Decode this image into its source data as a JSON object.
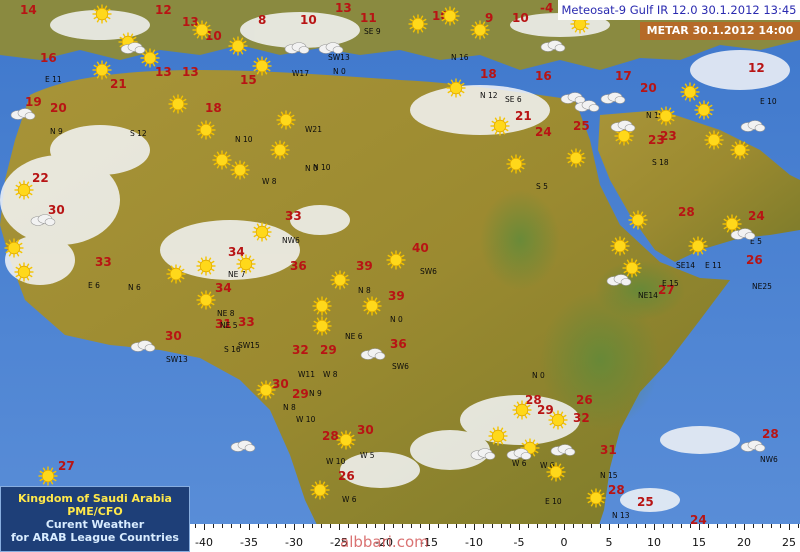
{
  "header": {
    "satellite_line": "Meteosat-9 Gulf IR 12.0  30.1.2012 13:45",
    "metar_line": "METAR 30.1.2012 14:00"
  },
  "info_box": {
    "line1": "Kingdom of Saudi Arabia",
    "line2": "PME/CFO",
    "line3": "Curent Weather",
    "line4": "for ARAB League Countries"
  },
  "watermark": "albbari.com",
  "longitude_scale": [
    "-40",
    "-35",
    "-30",
    "-25",
    "-20",
    "-15",
    "-10",
    "-5",
    "0",
    "5",
    "10",
    "15",
    "20",
    "25"
  ],
  "labels": [
    {
      "t": "14",
      "k": "temp"
    },
    {
      "t": "12",
      "k": "temp"
    },
    {
      "t": "13",
      "k": "temp"
    },
    {
      "t": "10",
      "k": "temp"
    },
    {
      "t": "8",
      "k": "temp"
    },
    {
      "t": "10",
      "k": "temp"
    },
    {
      "t": "13",
      "k": "temp"
    },
    {
      "t": "11",
      "k": "temp"
    },
    {
      "t": "10",
      "k": "temp"
    },
    {
      "t": "9",
      "k": "temp"
    },
    {
      "t": "10",
      "k": "temp"
    },
    {
      "t": "-4",
      "k": "temp"
    },
    {
      "t": "16",
      "k": "temp"
    },
    {
      "t": "19",
      "k": "temp"
    },
    {
      "t": "20",
      "k": "temp"
    },
    {
      "t": "21",
      "k": "temp"
    },
    {
      "t": "13",
      "k": "temp"
    },
    {
      "t": "13",
      "k": "temp"
    },
    {
      "t": "15",
      "k": "temp"
    },
    {
      "t": "18",
      "k": "temp"
    },
    {
      "t": "18",
      "k": "temp"
    },
    {
      "t": "16",
      "k": "temp"
    },
    {
      "t": "17",
      "k": "temp"
    },
    {
      "t": "20",
      "k": "temp"
    },
    {
      "t": "12",
      "k": "temp"
    },
    {
      "t": "21",
      "k": "temp"
    },
    {
      "t": "24",
      "k": "temp"
    },
    {
      "t": "25",
      "k": "temp"
    },
    {
      "t": "23",
      "k": "temp"
    },
    {
      "t": "22",
      "k": "temp"
    },
    {
      "t": "30",
      "k": "temp"
    },
    {
      "t": "33",
      "k": "temp"
    },
    {
      "t": "34",
      "k": "temp"
    },
    {
      "t": "36",
      "k": "temp"
    },
    {
      "t": "40",
      "k": "temp"
    },
    {
      "t": "39",
      "k": "temp"
    },
    {
      "t": "33",
      "k": "temp"
    },
    {
      "t": "34",
      "k": "temp"
    },
    {
      "t": "33",
      "k": "temp"
    },
    {
      "t": "39",
      "k": "temp"
    },
    {
      "t": "32",
      "k": "temp"
    },
    {
      "t": "29",
      "k": "temp"
    },
    {
      "t": "36",
      "k": "temp"
    },
    {
      "t": "30",
      "k": "temp"
    },
    {
      "t": "31",
      "k": "temp"
    },
    {
      "t": "30",
      "k": "temp"
    },
    {
      "t": "29",
      "k": "temp"
    },
    {
      "t": "28",
      "k": "temp"
    },
    {
      "t": "30",
      "k": "temp"
    },
    {
      "t": "26",
      "k": "temp"
    },
    {
      "t": "27",
      "k": "temp"
    },
    {
      "t": "28",
      "k": "temp"
    },
    {
      "t": "29",
      "k": "temp"
    },
    {
      "t": "32",
      "k": "temp"
    },
    {
      "t": "26",
      "k": "temp"
    },
    {
      "t": "31",
      "k": "temp"
    },
    {
      "t": "28",
      "k": "temp"
    },
    {
      "t": "25",
      "k": "temp"
    },
    {
      "t": "24",
      "k": "temp"
    },
    {
      "t": "28",
      "k": "temp"
    },
    {
      "t": "28",
      "k": "temp"
    },
    {
      "t": "24",
      "k": "temp"
    },
    {
      "t": "26",
      "k": "temp"
    },
    {
      "t": "27",
      "k": "temp"
    },
    {
      "t": "23",
      "k": "temp"
    },
    {
      "t": "E 11",
      "k": "wind"
    },
    {
      "t": "N 9",
      "k": "wind"
    },
    {
      "t": "S 12",
      "k": "wind"
    },
    {
      "t": "N 10",
      "k": "wind"
    },
    {
      "t": "W21",
      "k": "wind"
    },
    {
      "t": "N 0",
      "k": "wind"
    },
    {
      "t": "W 8",
      "k": "wind"
    },
    {
      "t": "N 12",
      "k": "wind"
    },
    {
      "t": "SE 6",
      "k": "wind"
    },
    {
      "t": "S 5",
      "k": "wind"
    },
    {
      "t": "NW6",
      "k": "wind"
    },
    {
      "t": "NE 7",
      "k": "wind"
    },
    {
      "t": "N 6",
      "k": "wind"
    },
    {
      "t": "E 6",
      "k": "wind"
    },
    {
      "t": "SW6",
      "k": "wind"
    },
    {
      "t": "NE 8",
      "k": "wind"
    },
    {
      "t": "NE 5",
      "k": "wind"
    },
    {
      "t": "NE 6",
      "k": "wind"
    },
    {
      "t": "N 8",
      "k": "wind"
    },
    {
      "t": "N 0",
      "k": "wind"
    },
    {
      "t": "SW13",
      "k": "wind"
    },
    {
      "t": "S 16",
      "k": "wind"
    },
    {
      "t": "SW15",
      "k": "wind"
    },
    {
      "t": "W11",
      "k": "wind"
    },
    {
      "t": "W 8",
      "k": "wind"
    },
    {
      "t": "SW6",
      "k": "wind"
    },
    {
      "t": "N 9",
      "k": "wind"
    },
    {
      "t": "N 8",
      "k": "wind"
    },
    {
      "t": "W 10",
      "k": "wind"
    },
    {
      "t": "W 5",
      "k": "wind"
    },
    {
      "t": "W 10",
      "k": "wind"
    },
    {
      "t": "W 6",
      "k": "wind"
    },
    {
      "t": "SE13",
      "k": "wind"
    },
    {
      "t": "E 10",
      "k": "wind"
    },
    {
      "t": "N 13",
      "k": "wind"
    },
    {
      "t": "N 15",
      "k": "wind"
    },
    {
      "t": "W 6",
      "k": "wind"
    },
    {
      "t": "NE14",
      "k": "wind"
    },
    {
      "t": "E 15",
      "k": "wind"
    },
    {
      "t": "SE14",
      "k": "wind"
    },
    {
      "t": "E 11",
      "k": "wind"
    },
    {
      "t": "NE25",
      "k": "wind"
    },
    {
      "t": "E 5",
      "k": "wind"
    },
    {
      "t": "NW6",
      "k": "wind"
    },
    {
      "t": "SE 9",
      "k": "wind"
    },
    {
      "t": "N 16",
      "k": "wind"
    },
    {
      "t": "SW13",
      "k": "wind"
    },
    {
      "t": "W17",
      "k": "wind"
    },
    {
      "t": "N 0",
      "k": "wind"
    },
    {
      "t": "N 10",
      "k": "wind"
    },
    {
      "t": "S 18",
      "k": "wind"
    },
    {
      "t": "N 10",
      "k": "wind"
    },
    {
      "t": "E 10",
      "k": "wind"
    },
    {
      "t": "W 6",
      "k": "wind"
    },
    {
      "t": "N 0",
      "k": "wind"
    }
  ]
}
